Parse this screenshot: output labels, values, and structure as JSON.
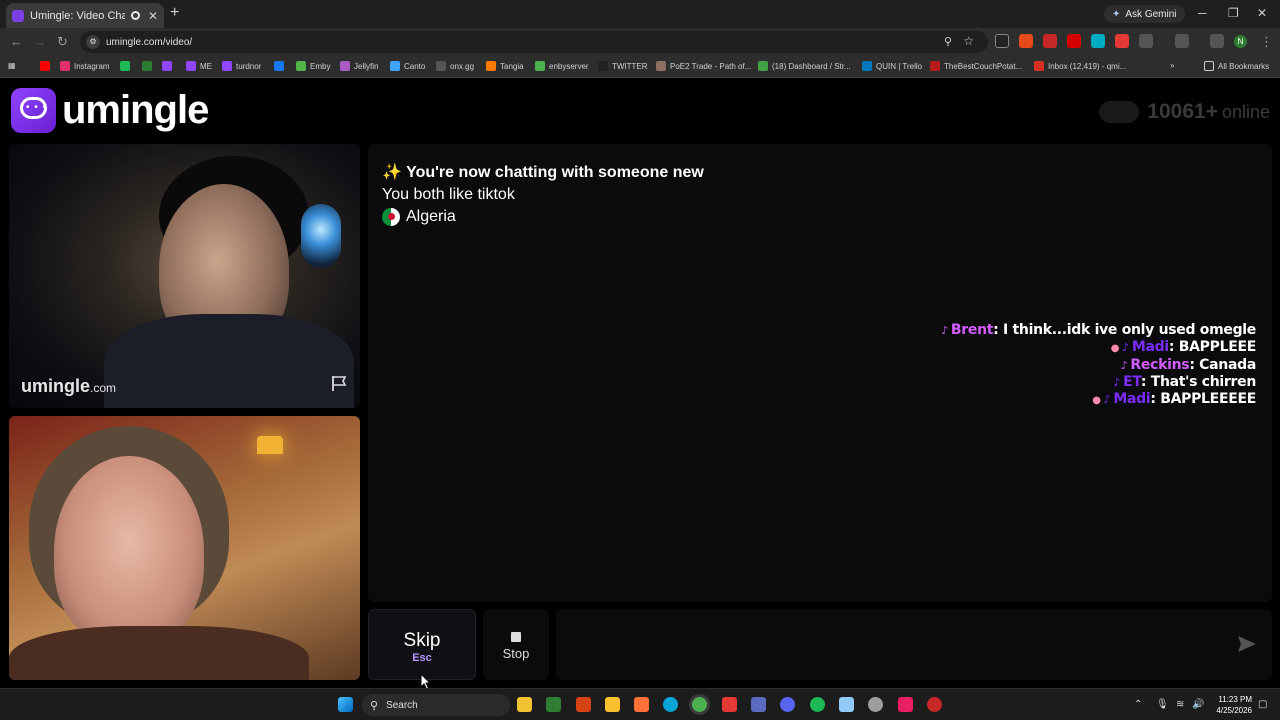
{
  "browser": {
    "tab_title": "Umingle: Video Chat with S",
    "new_tab": "+",
    "ask_gemini": "Ask Gemini",
    "url": "umingle.com/video/",
    "bookmarks": [
      {
        "label": "",
        "color": "#ff0000"
      },
      {
        "label": "Instagram",
        "color": "#e1306c"
      },
      {
        "label": "",
        "color": "#1db954"
      },
      {
        "label": "",
        "color": "#2e7d32"
      },
      {
        "label": "",
        "color": "#9146ff"
      },
      {
        "label": "ME",
        "color": "#9146ff"
      },
      {
        "label": "turdnor",
        "color": "#9146ff"
      },
      {
        "label": "",
        "color": "#1877f2"
      },
      {
        "label": "Emby",
        "color": "#52b54b"
      },
      {
        "label": "Jellyfin",
        "color": "#aa5cc3"
      },
      {
        "label": "Canto",
        "color": "#3ea6ff"
      },
      {
        "label": "onx.gg",
        "color": "#555555"
      },
      {
        "label": "Tangia",
        "color": "#ff7a00"
      },
      {
        "label": "enbyserver",
        "color": "#4caf50"
      },
      {
        "label": "TWITTER",
        "color": "#222222"
      },
      {
        "label": "PoE2 Trade - Path of...",
        "color": "#8d6e63"
      },
      {
        "label": "(18) Dashboard / Str...",
        "color": "#43a047"
      },
      {
        "label": "QUIN | Trello",
        "color": "#0079bf"
      },
      {
        "label": "TheBestCouchPotat...",
        "color": "#b71c1c"
      },
      {
        "label": "Inbox (12,419) - qmi...",
        "color": "#d93025"
      }
    ],
    "all_bookmarks": "All Bookmarks"
  },
  "site": {
    "logo_text": "umingle",
    "online_count": "10061",
    "online_plus": "+",
    "online_label": "online",
    "watermark": "umingle",
    "watermark_suffix": ".com"
  },
  "chat": {
    "headline": "✨ You're now chatting with someone new",
    "interest": "You both like tiktok",
    "country": "Algeria"
  },
  "overlay_messages": [
    {
      "badge": "",
      "user": "Brent",
      "user_color": "#d25cff",
      "text": ": I think...idk ive only used omegle"
    },
    {
      "badge": "●",
      "user": "Madi",
      "user_color": "#7a2cff",
      "text": ": BAPPLEEE"
    },
    {
      "badge": "",
      "user": "Reckins",
      "user_color": "#d25cff",
      "text": ": Canada"
    },
    {
      "badge": "",
      "user": "ET",
      "user_color": "#7a2cff",
      "text": ": That's chirren"
    },
    {
      "badge": "●",
      "user": "Madi",
      "user_color": "#7a2cff",
      "text": ": BAPPLEEEEE"
    }
  ],
  "controls": {
    "skip_label": "Skip",
    "skip_key": "Esc",
    "stop_label": "Stop",
    "message_placeholder": ""
  },
  "taskbar": {
    "search_label": "Search",
    "time": "11:23 PM",
    "date": "4/25/2026"
  }
}
